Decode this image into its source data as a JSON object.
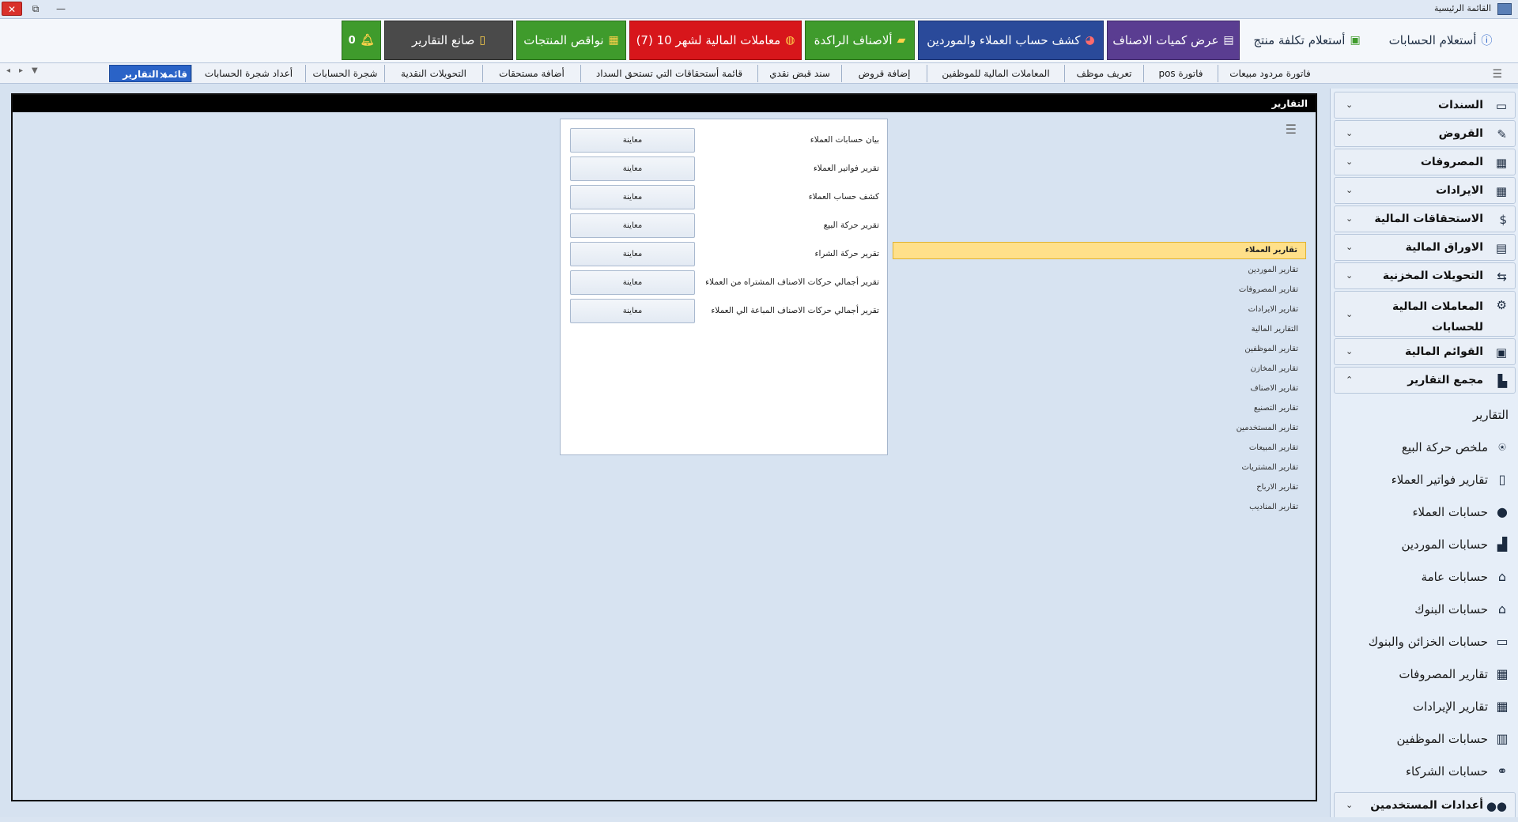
{
  "window": {
    "title": "القائمة الرئيسية",
    "close_icon": "✕",
    "restore_icon": "⧉",
    "min_icon": "—"
  },
  "toolbar": {
    "inquiry_accounts": "أستعلام الحسابات",
    "inquiry_product_cost": "أستعلام تكلفة منتج",
    "show_item_quantities": "عرض كميات الاصناف",
    "customer_supplier_statement": "كشف حساب العملاء والموردين",
    "stagnant_items": "ألاصناف الراكدة",
    "monthly_transactions": "معاملات المالية لشهر 10  (7)",
    "product_shortages": "نواقص المنتجات",
    "report_maker": "صانع التقارير",
    "notifications_count": "0"
  },
  "tabs": {
    "items": [
      "فاتورة مردود مبيعات",
      "فاتورة pos",
      "تعريف موظف",
      "المعاملات المالية للموظفين",
      "إضافة قروض",
      "سند قبض نقدي",
      "قائمة أستحقاقات التي تستحق السداد",
      "أضافة مستحقات",
      "التحويلات النقدية",
      "شجرة الحسابات",
      "أعداد شجرة الحسابات"
    ],
    "active": "قائمة التقارير"
  },
  "main": {
    "header": "التقارير",
    "report_categories": [
      "تقارير العملاء",
      "تقارير الموردين",
      "تقارير المصروفات",
      "تقارير الايرادات",
      "التقارير المالية",
      "تقارير الموظفين",
      "تقارير المخازن",
      "تقارير الاصناف",
      "تقارير التصنيع",
      "تقارير المستخدمين",
      "تقارير المبيعات",
      "تقارير المشتريات",
      "تقارير الارباح",
      "تقارير المناديب"
    ],
    "reports": [
      "بيان حسابات العملاء",
      "تقرير فواتير العملاء",
      "كشف حساب العملاء",
      "تقرير حركة البيع",
      "تقرير حركة الشراء",
      "تقرير أجمالي حركات الاصناف المشتراه من العملاء",
      "تقرير أجمالي حركات الاصناف المباعة الي العملاء"
    ],
    "preview_label": "معاينة"
  },
  "sidebar": {
    "groups": [
      "السندات",
      "القروض",
      "المصروفات",
      "الايرادات",
      "الاستحقاقات المالية",
      "الاوراق المالية",
      "التحويلات المخزنية",
      "المعاملات المالية للحسابات",
      "القوائم المالية",
      "مجمع التقارير"
    ],
    "subheader": "التقارير",
    "subitems": [
      "ملخص حركة البيع",
      "تقارير فواتير العملاء",
      "حسابات العملاء",
      "حسابات الموردين",
      "حسابات عامة",
      "حسابات البنوك",
      "حسابات الخزائن والبنوك",
      "تقارير المصروفات",
      "تقارير الإيرادات",
      "حسابات الموظفين",
      "حسابات الشركاء"
    ],
    "users_settings": "أعدادات المستخدمين"
  },
  "colors": {
    "selected_category": "#ffe08a",
    "active_tab": "#2a63c7",
    "alert_red": "#d7161b"
  }
}
